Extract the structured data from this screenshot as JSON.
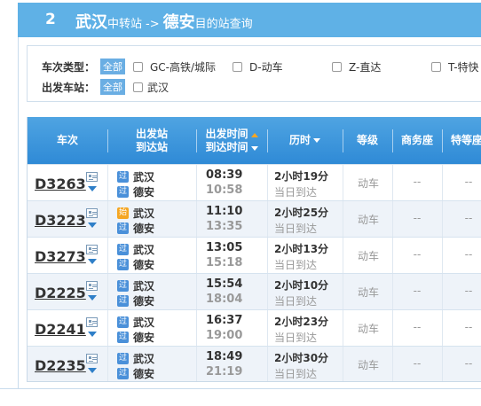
{
  "step": {
    "number": "2",
    "from_city": "武汉",
    "transfer_text": "中转站",
    "arrow": "->",
    "to_city": "德安",
    "dest_text": "目的站查询"
  },
  "filters": {
    "type_label": "车次类型：",
    "depart_label": "出发车站：",
    "all_label": "全部",
    "type_options": [
      "GC-高铁/城际",
      "D-动车",
      "Z-直达",
      "T-特快"
    ],
    "depart_options": [
      "武汉"
    ]
  },
  "table": {
    "headers": {
      "train": "车次",
      "station_top": "出发站",
      "station_bottom": "到达站",
      "time_top": "出发时间",
      "time_bottom": "到达时间",
      "duration": "历时",
      "grade": "等级",
      "business": "商务座",
      "special": "特等座"
    },
    "rows": [
      {
        "train": "D3263",
        "from_badge": "过",
        "from": "武汉",
        "to_badge": "过",
        "to": "德安",
        "dep": "08:39",
        "arr": "10:58",
        "duration": "2小时19分",
        "arrival_note": "当日到达",
        "grade": "动车",
        "business": "--",
        "special": "--"
      },
      {
        "train": "D3223",
        "from_badge": "始",
        "from": "武汉",
        "to_badge": "过",
        "to": "德安",
        "dep": "11:10",
        "arr": "13:35",
        "duration": "2小时25分",
        "arrival_note": "当日到达",
        "grade": "动车",
        "business": "--",
        "special": "--"
      },
      {
        "train": "D3273",
        "from_badge": "过",
        "from": "武汉",
        "to_badge": "过",
        "to": "德安",
        "dep": "13:05",
        "arr": "15:18",
        "duration": "2小时13分",
        "arrival_note": "当日到达",
        "grade": "动车",
        "business": "--",
        "special": "--"
      },
      {
        "train": "D2225",
        "from_badge": "过",
        "from": "武汉",
        "to_badge": "过",
        "to": "德安",
        "dep": "15:54",
        "arr": "18:04",
        "duration": "2小时10分",
        "arrival_note": "当日到达",
        "grade": "动车",
        "business": "--",
        "special": "--"
      },
      {
        "train": "D2241",
        "from_badge": "过",
        "from": "武汉",
        "to_badge": "过",
        "to": "德安",
        "dep": "16:37",
        "arr": "19:00",
        "duration": "2小时23分",
        "arrival_note": "当日到达",
        "grade": "动车",
        "business": "--",
        "special": "--"
      },
      {
        "train": "D2235",
        "from_badge": "过",
        "from": "武汉",
        "to_badge": "过",
        "to": "德安",
        "dep": "18:49",
        "arr": "21:19",
        "duration": "2小时30分",
        "arrival_note": "当日到达",
        "grade": "动车",
        "business": "--",
        "special": "--"
      }
    ]
  },
  "colors": {
    "header_bar": "#5fb1e6",
    "table_head": "#2f8ad6",
    "badge_pass": "#4a90d9",
    "badge_start": "#f5a623"
  }
}
